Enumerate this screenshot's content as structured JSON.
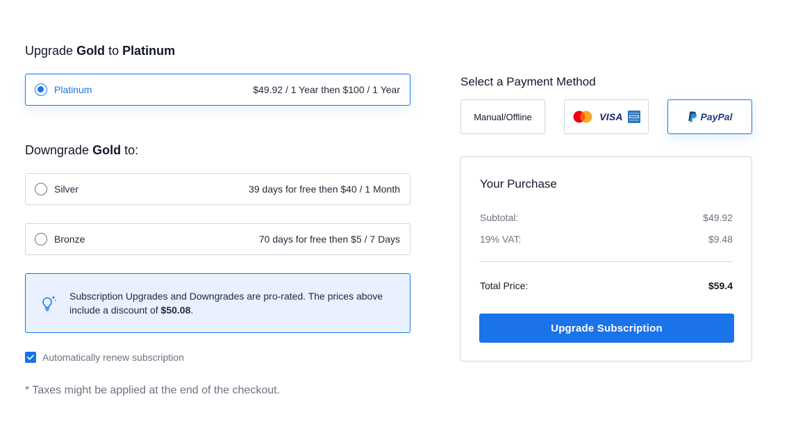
{
  "upgrade": {
    "heading_prefix": "Upgrade",
    "heading_from": "Gold",
    "heading_mid": "to",
    "heading_to": "Platinum",
    "option": {
      "name": "Platinum",
      "price": "$49.92 / 1 Year then $100 / 1 Year",
      "selected": true
    }
  },
  "downgrade": {
    "heading_prefix": "Downgrade",
    "heading_from": "Gold",
    "heading_suffix": "to:",
    "options": [
      {
        "name": "Silver",
        "price": "39 days for free then $40 / 1 Month",
        "selected": false
      },
      {
        "name": "Bronze",
        "price": "70 days for free then $5 / 7 Days",
        "selected": false
      }
    ]
  },
  "notice": {
    "icon": "lightbulb-icon",
    "text": "Subscription Upgrades and Downgrades are pro-rated. The prices above include a discount of",
    "discount": "$50.08",
    "suffix": "."
  },
  "renew": {
    "label": "Automatically renew subscription",
    "checked": true
  },
  "taxes_note": "* Taxes might be applied at the end of the checkout.",
  "payment": {
    "title": "Select a Payment Method",
    "methods": [
      {
        "id": "manual",
        "label": "Manual/Offline",
        "selected": false
      },
      {
        "id": "cards",
        "label": "",
        "icons": [
          "mastercard-icon",
          "visa-icon",
          "amex-icon"
        ],
        "visa_text": "VISA",
        "selected": false
      },
      {
        "id": "paypal",
        "label": "PayPal",
        "icon": "paypal-icon",
        "selected": true
      }
    ]
  },
  "purchase": {
    "title": "Your Purchase",
    "subtotal_label": "Subtotal:",
    "subtotal_value": "$49.92",
    "vat_label": "19% VAT:",
    "vat_value": "$9.48",
    "total_label": "Total Price:",
    "total_value": "$59.4",
    "button_label": "Upgrade Subscription"
  },
  "colors": {
    "accent": "#1a73e8",
    "notice_bg": "#e8f1fd",
    "paypal_dark": "#253b80",
    "paypal_light": "#179bd7",
    "visa": "#1a1f71",
    "mastercard_red": "#eb001b",
    "mastercard_orange": "#f79e1b",
    "amex": "#2e77bc"
  }
}
